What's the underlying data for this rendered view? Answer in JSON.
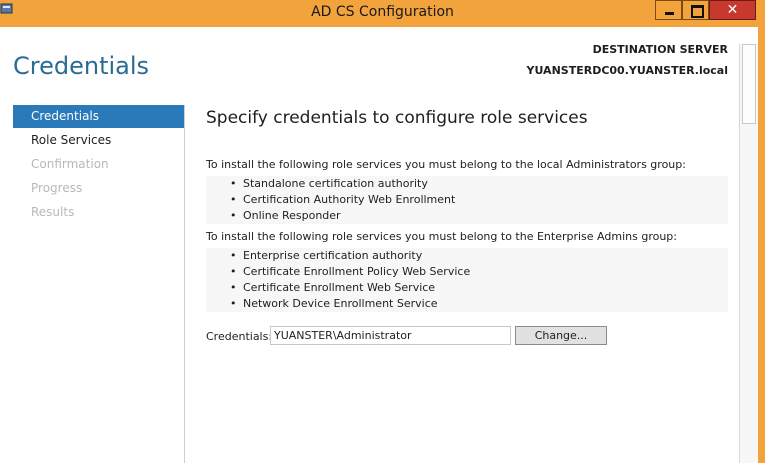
{
  "window": {
    "title": "AD CS Configuration",
    "close_label": "✕",
    "accent_color": "#f3a33b"
  },
  "header": {
    "title": "Credentials",
    "destination_label": "DESTINATION SERVER",
    "destination_value": "YUANSTERDC00.YUANSTER.local"
  },
  "nav": {
    "items": [
      {
        "label": "Credentials",
        "state": "active"
      },
      {
        "label": "Role Services",
        "state": "enabled"
      },
      {
        "label": "Confirmation",
        "state": "disabled"
      },
      {
        "label": "Progress",
        "state": "disabled"
      },
      {
        "label": "Results",
        "state": "disabled"
      }
    ]
  },
  "main": {
    "heading": "Specify credentials to configure role services",
    "local_admins_text": "To install the following role services you must belong to the local Administrators group:",
    "local_admins_roles": [
      "Standalone certification authority",
      "Certification Authority Web Enrollment",
      "Online Responder"
    ],
    "enterprise_admins_text": "To install the following role services you must belong to the Enterprise Admins group:",
    "enterprise_admins_roles": [
      "Enterprise certification authority",
      "Certificate Enrollment Policy Web Service",
      "Certificate Enrollment Web Service",
      "Network Device Enrollment Service"
    ],
    "bullet_glyph": "•",
    "credentials_label": "Credentials:",
    "credentials_value": "YUANSTER\\Administrator",
    "change_button": "Change..."
  }
}
